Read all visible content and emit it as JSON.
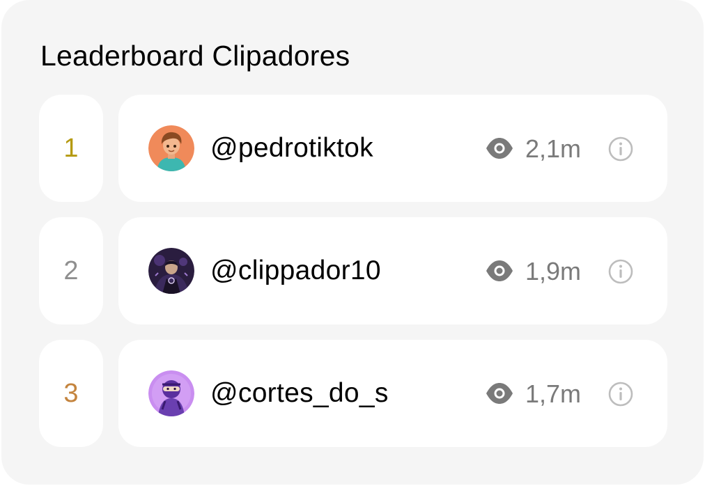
{
  "leaderboard": {
    "title": "Leaderboard Clipadores",
    "rows": [
      {
        "rank": "1",
        "rank_color": "#b59a12",
        "username": "@pedrotiktok",
        "views": "2,1m",
        "avatar": "cartoon-boy-avatar"
      },
      {
        "rank": "2",
        "rank_color": "#8f8f8f",
        "username": "@clippador10",
        "views": "1,9m",
        "avatar": "dark-gamer-avatar"
      },
      {
        "rank": "3",
        "rank_color": "#c4843e",
        "username": "@cortes_do_s",
        "views": "1,7m",
        "avatar": "purple-ninja-avatar"
      }
    ]
  },
  "icons": {
    "views": "eye-icon",
    "info": "info-icon"
  },
  "colors": {
    "card_background": "#f5f5f5",
    "row_background": "#ffffff",
    "secondary_text": "#7a7a7a"
  }
}
